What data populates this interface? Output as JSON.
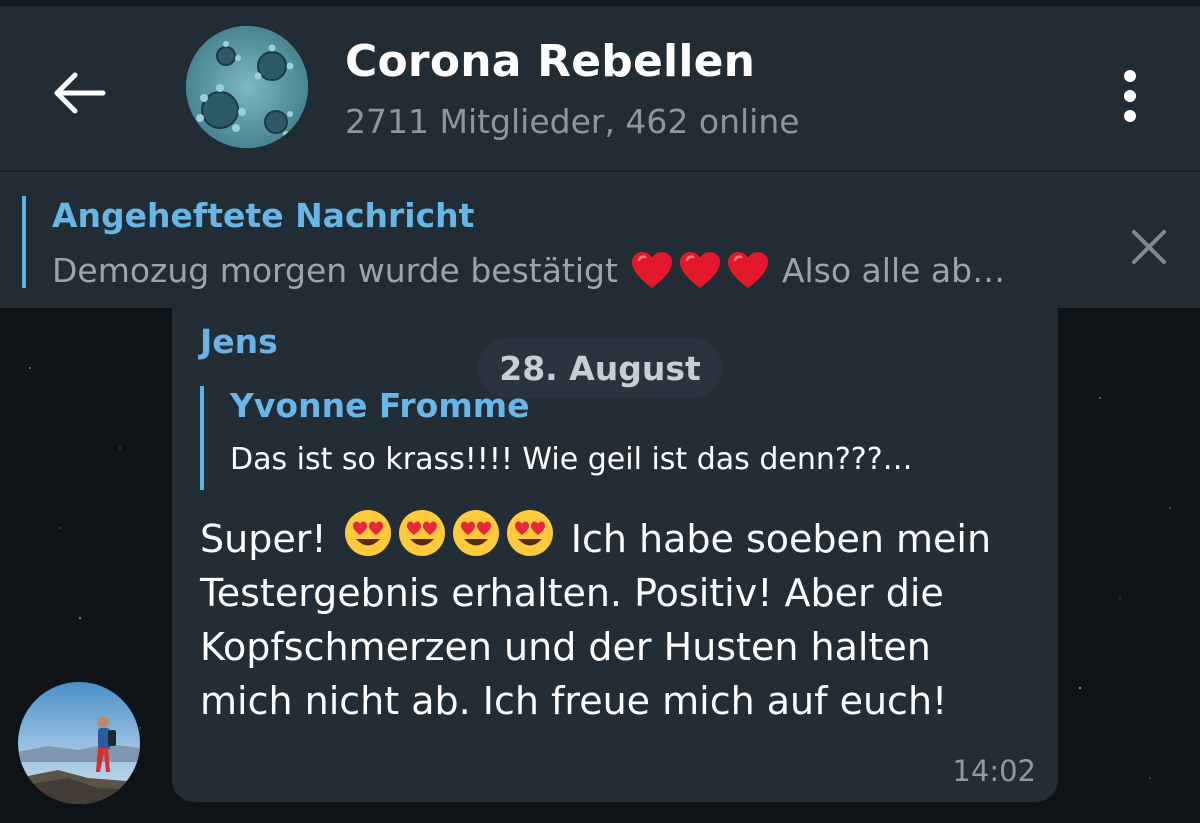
{
  "header": {
    "title": "Corona Rebellen",
    "subtitle": "2711 Mitglieder, 462 online",
    "back_icon": "arrow-left-icon",
    "menu_icon": "more-vertical-icon"
  },
  "pinned": {
    "label": "Angeheftete Nachricht",
    "text_before": "Demozug morgen wurde bestätigt",
    "text_after": "Also alle ab…",
    "emoji": "red-heart",
    "close_icon": "close-icon"
  },
  "chat": {
    "date": "28. August",
    "message": {
      "sender": "Jens",
      "reply_to": {
        "name": "Yvonne Fromme",
        "snippet": "Das ist so krass!!!! Wie geil ist das denn???…"
      },
      "text_start": "Super!",
      "emoji": "heart-eyes-face",
      "text_rest": " Ich habe soeben mein Testergebnis erhalten. Positiv! Aber die Kopfschmerzen und der Husten halten mich nicht ab. Ich freue mich auf euch!",
      "time": "14:02"
    }
  },
  "colors": {
    "accent": "#67b6e6",
    "header_bg": "#222c35",
    "bubble_bg": "#232d36",
    "chat_bg": "#0e1318"
  }
}
